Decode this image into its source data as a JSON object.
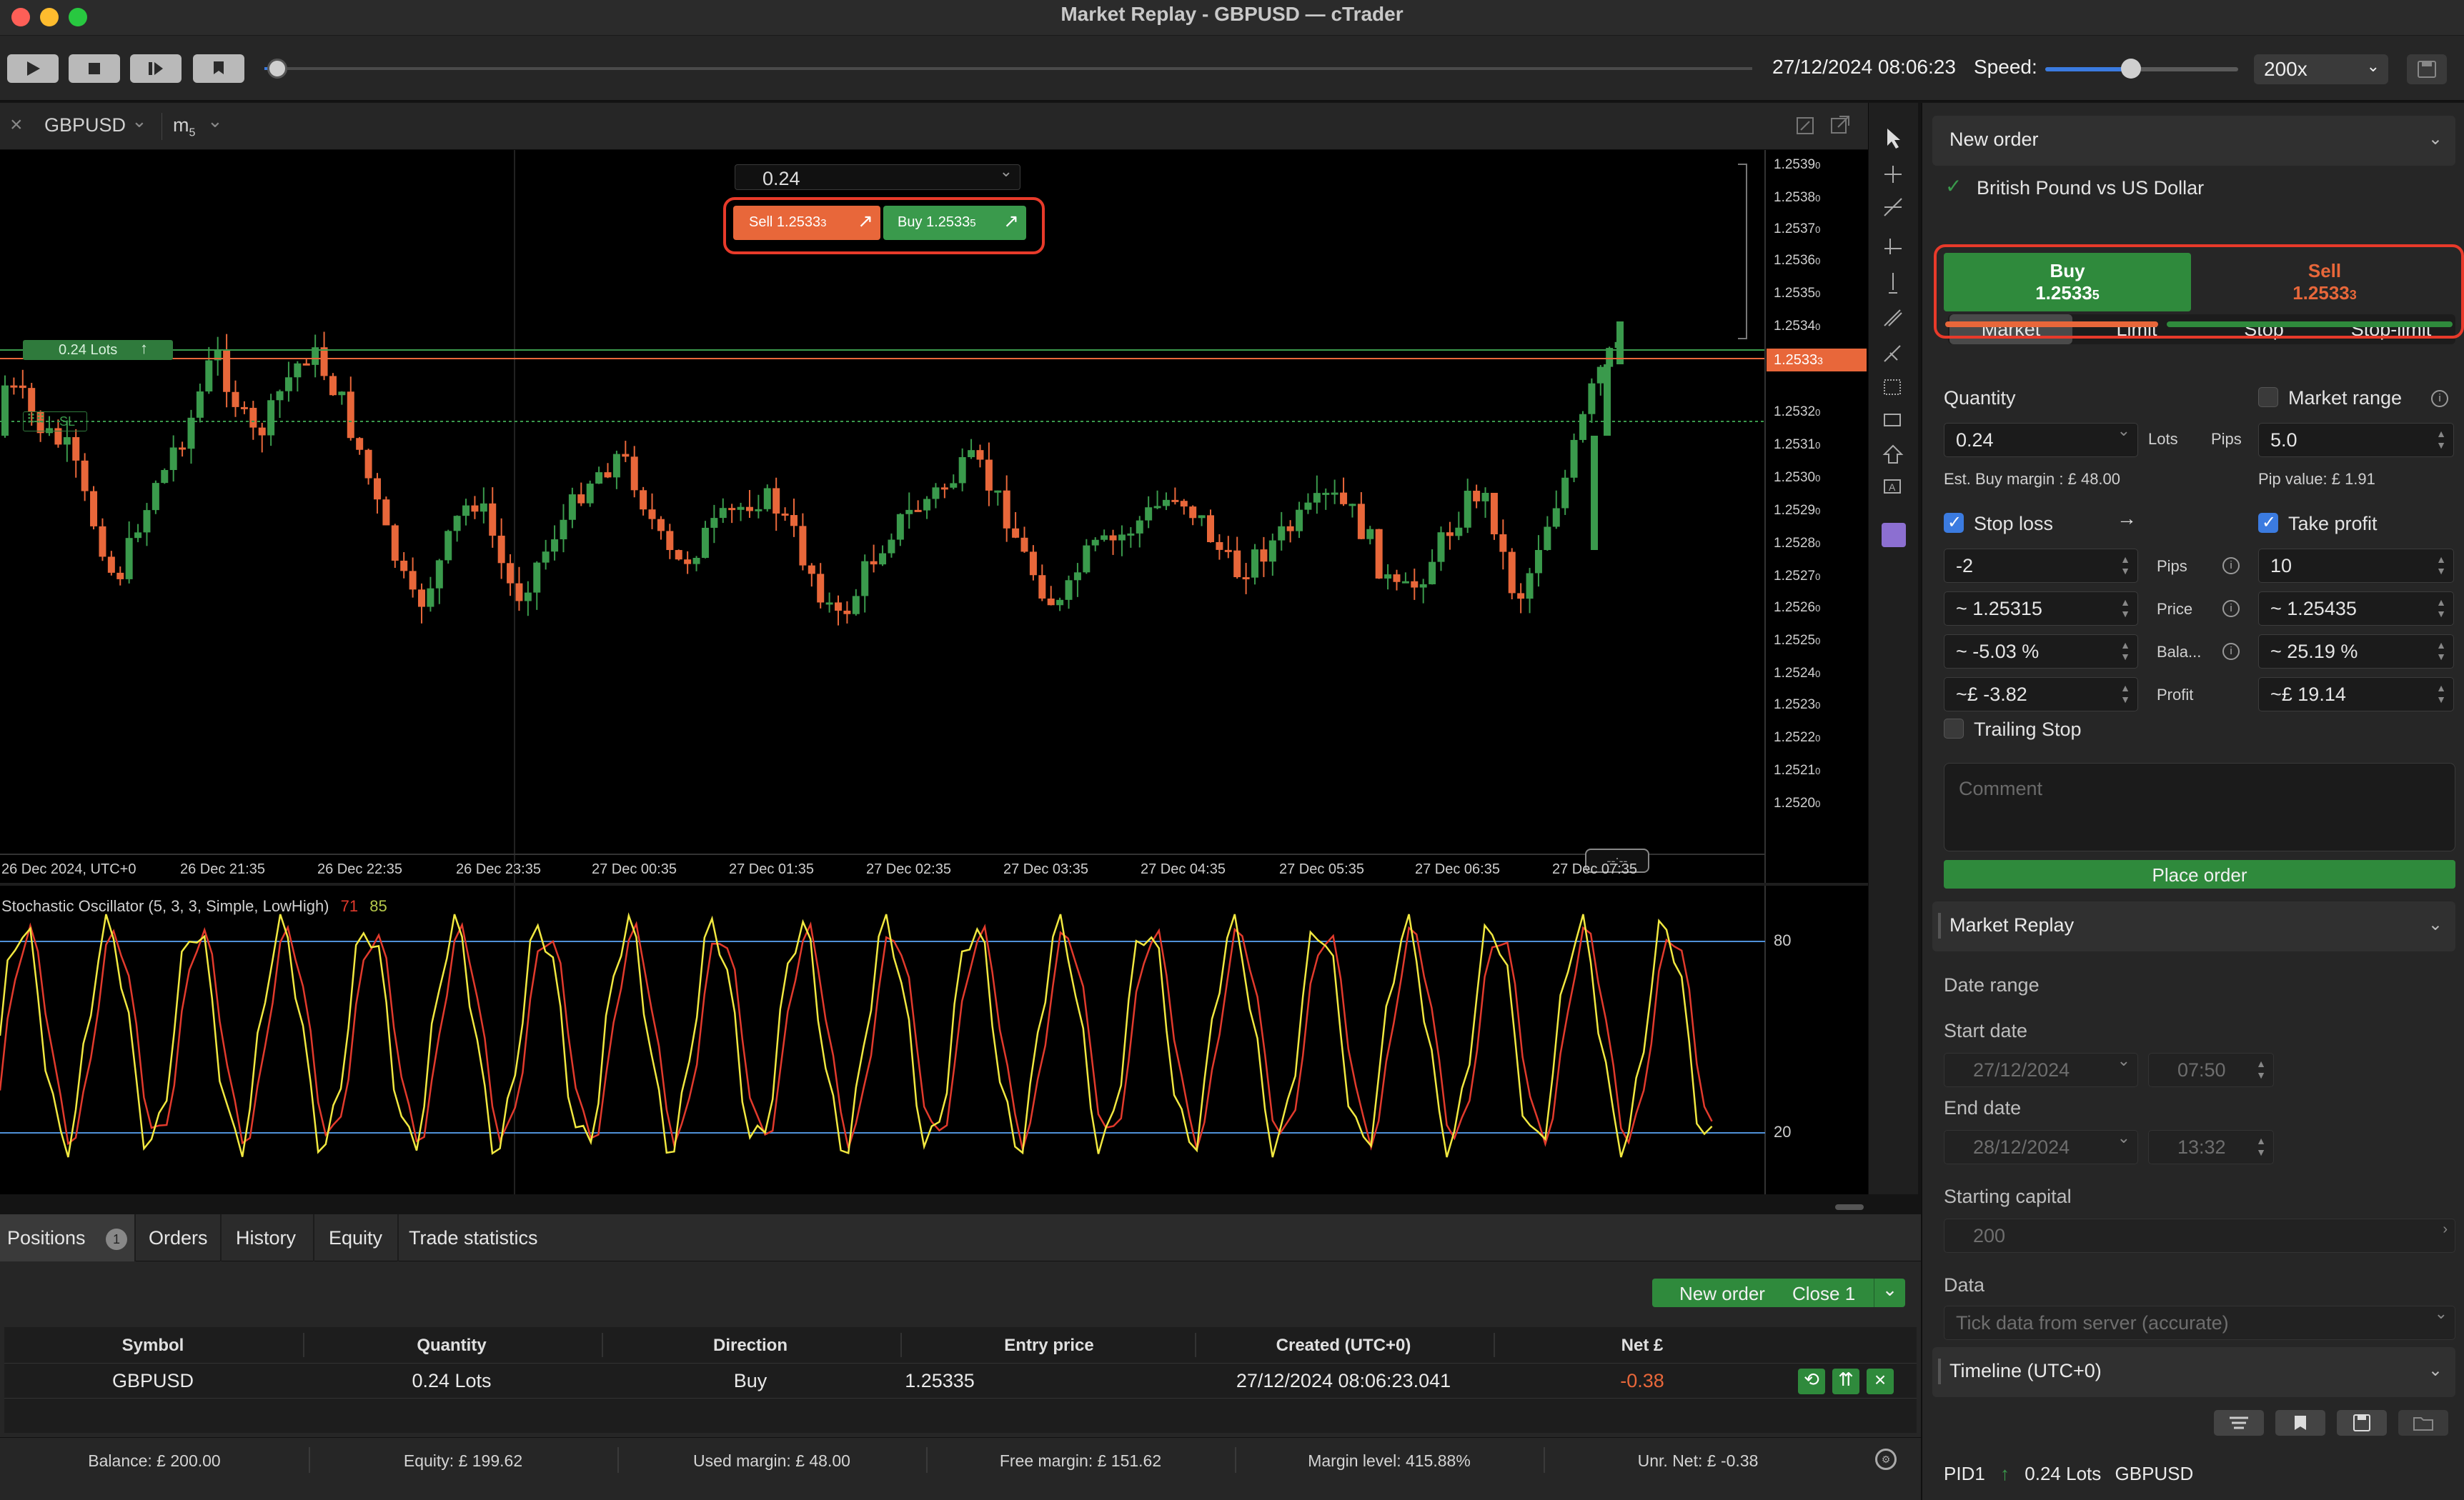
{
  "window": {
    "title": "Market Replay - GBPUSD — cTrader"
  },
  "playback": {
    "datetime": "27/12/2024 08:06:23",
    "speed_label": "Speed:",
    "speed_value": "200x"
  },
  "chart_tabs": {
    "symbol": "GBPUSD",
    "timeframe": "m",
    "timeframe_sub": "5"
  },
  "chart": {
    "quick_volume": "0.24",
    "sell_button": "Sell 1.2533",
    "sell_button_sup": "3",
    "buy_button": "Buy 1.2533",
    "buy_button_sup": "5",
    "position_label": "0.24 Lots",
    "sl_label": "SL",
    "current_price": "1.2533",
    "current_price_sup": "3",
    "price_ticks": [
      "1.2539",
      "1.2538",
      "1.2537",
      "1.2536",
      "1.2535",
      "1.2534",
      "1.2532",
      "1.2531",
      "1.2530",
      "1.2529",
      "1.2528",
      "1.2527",
      "1.2526",
      "1.2525",
      "1.2524",
      "1.2523",
      "1.2522",
      "1.2521",
      "1.2520"
    ],
    "price_tick_sup": "0",
    "time_ticks": [
      "26 Dec 2024, UTC+0",
      "26 Dec 21:35",
      "26 Dec 22:35",
      "26 Dec 23:35",
      "27 Dec 00:35",
      "27 Dec 01:35",
      "27 Dec 02:35",
      "27 Dec 03:35",
      "27 Dec 04:35",
      "27 Dec 05:35",
      "27 Dec 06:35",
      "27 Dec 07:35"
    ],
    "cursor_time": "--:--",
    "indicator_label": "Stochastic Oscillator (5, 3, 3, Simple, LowHigh)",
    "indicator_k": "71",
    "indicator_d": "85",
    "indicator_levels": [
      "80",
      "20"
    ],
    "colors": {
      "bull": "#3a9a4c",
      "bear": "#e8673a",
      "k_line": "#f1e840",
      "d_line": "#e23a2c",
      "level": "#4f90d8"
    }
  },
  "order_panel": {
    "header": "New order",
    "symbol_name": "British Pound vs US Dollar",
    "order_types": [
      "Market",
      "Limit",
      "Stop",
      "Stop-limit"
    ],
    "buy_label": "Buy",
    "buy_price": "1.2533",
    "buy_price_sup": "5",
    "sell_label": "Sell",
    "sell_price": "1.2533",
    "sell_price_sup": "3",
    "quantity_label": "Quantity",
    "market_range_label": "Market range",
    "quantity_value": "0.24",
    "lots_label": "Lots",
    "pips_label": "Pips",
    "range_value": "5.0",
    "est_margin": "Est. Buy margin : £ 48.00",
    "pip_value": "Pip value: £ 1.91",
    "stop_loss_label": "Stop loss",
    "take_profit_label": "Take profit",
    "row_labels": [
      "Pips",
      "Price",
      "Bala...",
      "Profit"
    ],
    "sl_values": [
      "-2",
      "~ 1.25315",
      "~ -5.03    %",
      "~£  -3.82"
    ],
    "tp_values": [
      "10",
      "~ 1.25435",
      "~ 25.19    %",
      "~£  19.14"
    ],
    "trailing_stop_label": "Trailing Stop",
    "comment_placeholder": "Comment",
    "place_order": "Place order"
  },
  "replay_panel": {
    "header": "Market Replay",
    "date_range_label": "Date range",
    "start_date_label": "Start date",
    "start_date": "27/12/2024",
    "start_time": "07:50",
    "end_date_label": "End date",
    "end_date": "28/12/2024",
    "end_time": "13:32",
    "capital_label": "Starting capital",
    "capital_value": "200",
    "data_label": "Data",
    "data_value": "Tick data from server (accurate)",
    "timeline_header": "Timeline (UTC+0)",
    "timeline_item": {
      "id": "PID1",
      "lots": "0.24 Lots",
      "symbol": "GBPUSD"
    }
  },
  "bottom": {
    "tabs": [
      "Positions",
      "Orders",
      "History",
      "Equity",
      "Trade statistics"
    ],
    "positions_count": "1",
    "new_order_btn": "New order",
    "close_btn": "Close 1",
    "columns": [
      "Symbol",
      "Quantity",
      "Direction",
      "Entry price",
      "Created (UTC+0)",
      "Net £"
    ],
    "row": {
      "symbol": "GBPUSD",
      "quantity": "0.24 Lots",
      "direction": "Buy",
      "entry": "1.25335",
      "created": "27/12/2024 08:06:23.041",
      "net": "-0.38"
    },
    "status": [
      "Balance: £ 200.00",
      "Equity: £ 199.62",
      "Used margin: £ 48.00",
      "Free margin: £ 151.62",
      "Margin level: 415.88%",
      "Unr. Net: £ -0.38"
    ]
  }
}
